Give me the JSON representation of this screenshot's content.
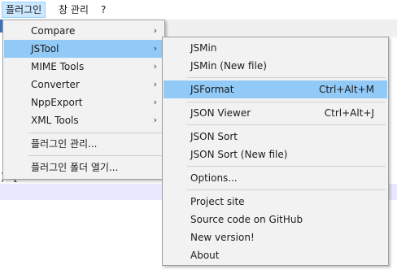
{
  "menubar": {
    "items": [
      "플러그인",
      "창 관리",
      "?"
    ]
  },
  "plugins_menu": {
    "items": [
      {
        "label": "Compare",
        "arrow": "›"
      },
      {
        "label": "JSTool",
        "arrow": "›"
      },
      {
        "label": "MIME Tools",
        "arrow": "›"
      },
      {
        "label": "Converter",
        "arrow": "›"
      },
      {
        "label": "NppExport",
        "arrow": "›"
      },
      {
        "label": "XML Tools",
        "arrow": "›"
      },
      {
        "label": "플러그인 관리..."
      },
      {
        "label": "플러그인 폴더 열기..."
      }
    ]
  },
  "jstool_menu": {
    "items": [
      {
        "label": "JSMin"
      },
      {
        "label": "JSMin (New file)"
      },
      {
        "label": "JSFormat",
        "shortcut": "Ctrl+Alt+M"
      },
      {
        "label": "JSON Viewer",
        "shortcut": "Ctrl+Alt+J"
      },
      {
        "label": "JSON Sort"
      },
      {
        "label": "JSON Sort (New file)"
      },
      {
        "label": "Options..."
      },
      {
        "label": "Project site"
      },
      {
        "label": "Source code on GitHub"
      },
      {
        "label": "New version!"
      },
      {
        "label": "About"
      }
    ]
  },
  "editor": {
    "fragment": ") {"
  },
  "colors": {
    "highlight": "#91c9f7",
    "menubar_active": "#cce8ff",
    "current_line": "#e8e8ff"
  }
}
